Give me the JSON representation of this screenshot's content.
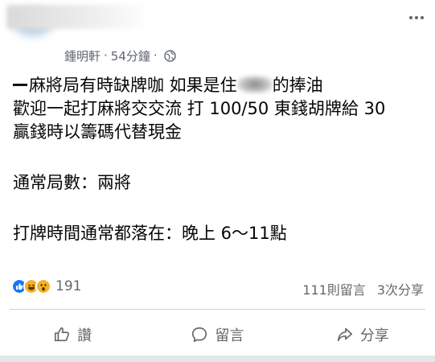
{
  "post": {
    "author": "鍾明軒",
    "time": "54分鐘",
    "separator": "·",
    "lines": {
      "l1_a": "麻將局有時缺牌咖 如果是住",
      "l1_b": "的捧油",
      "l2": "歡迎一起打麻將交交流 打 100/50 東錢胡牌給 30",
      "l3": "贏錢時以籌碼代替現金",
      "l4": "通常局數：兩將",
      "l5": "打牌時間通常都落在：晚上 6～11點"
    }
  },
  "reactions": {
    "icons": [
      "like-icon",
      "haha-icon",
      "wow-icon"
    ],
    "colors": {
      "like": "#1877f2",
      "haha": "#f7b125",
      "wow": "#f7b125"
    },
    "count": "191"
  },
  "stats": {
    "comments": "111則留言",
    "shares": "3次分享"
  },
  "actions": {
    "like": "讚",
    "comment": "留言",
    "share": "分享"
  }
}
